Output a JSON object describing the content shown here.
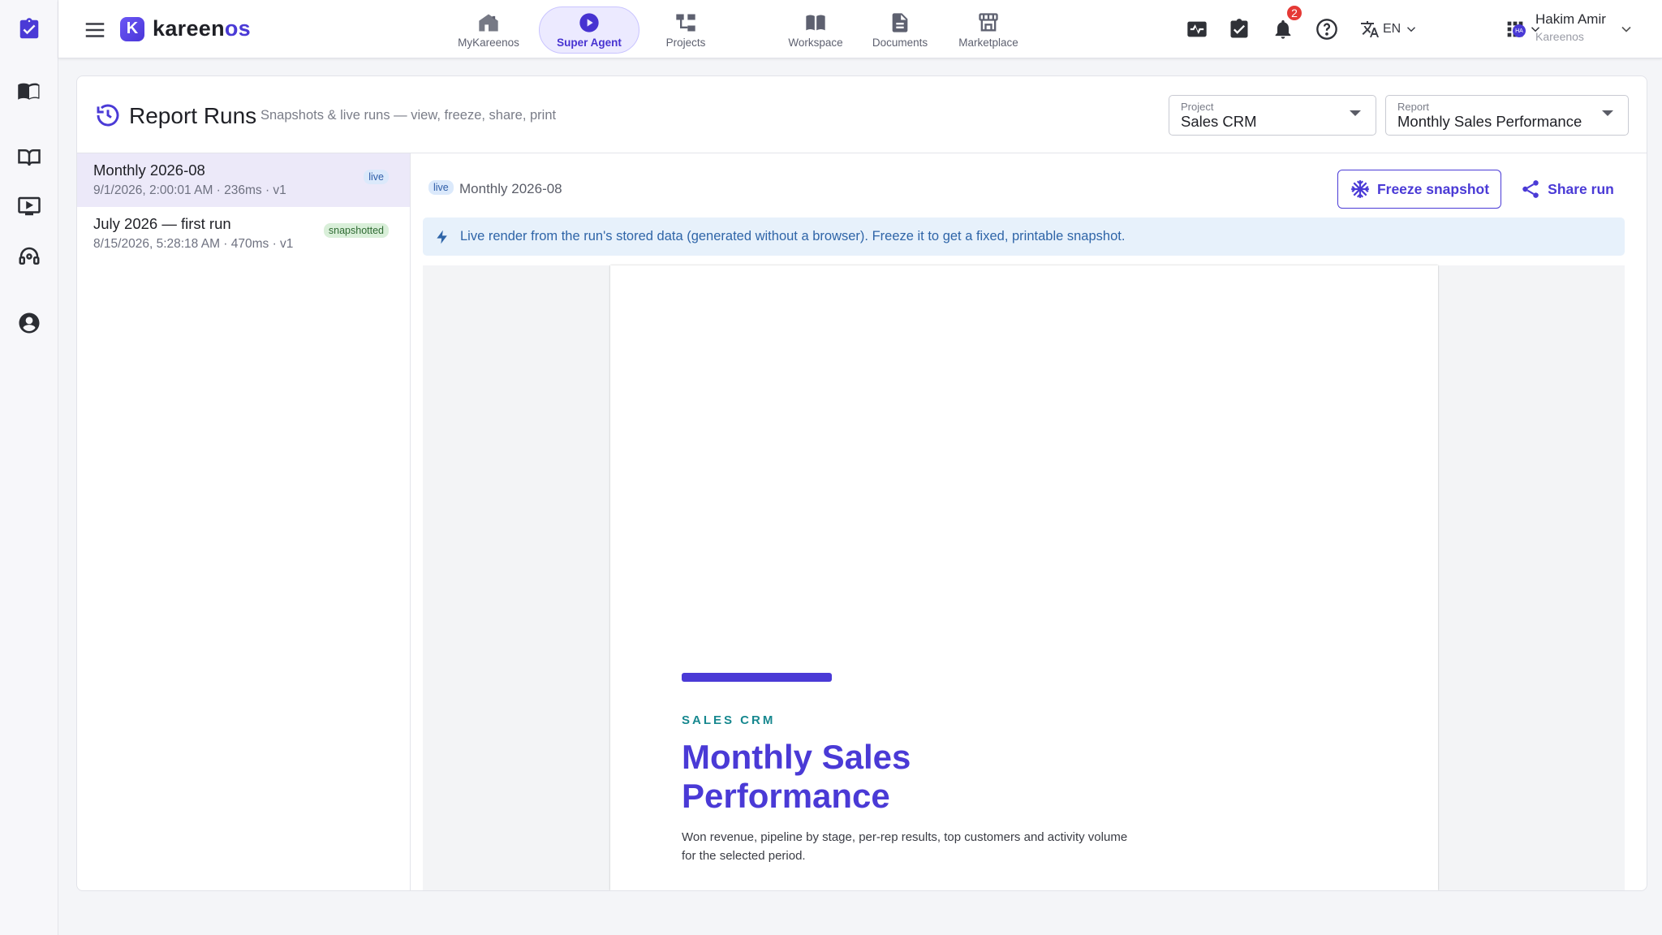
{
  "app": {
    "brand_main": "kareen",
    "brand_accent": "os",
    "logo_letter": "K"
  },
  "nav": [
    {
      "label": "MyKareenos",
      "icon": "home-icon"
    },
    {
      "label": "Super Agent",
      "icon": "play-circle-icon",
      "active": true
    },
    {
      "label": "Projects",
      "icon": "hierarchy-icon"
    },
    {
      "label": "Workspace",
      "icon": "book-icon"
    },
    {
      "label": "Documents",
      "icon": "document-icon"
    },
    {
      "label": "Marketplace",
      "icon": "store-icon"
    }
  ],
  "topbar": {
    "notifications_count": "2",
    "language": "EN"
  },
  "user": {
    "name": "Hakim Amir",
    "org": "Kareenos",
    "initials": "HA"
  },
  "page": {
    "title": "Report Runs",
    "subtitle": "Snapshots & live runs — view, freeze, share, print",
    "project_select": {
      "label": "Project",
      "value": "Sales CRM"
    },
    "report_select": {
      "label": "Report",
      "value": "Monthly Sales Performance"
    }
  },
  "runs": [
    {
      "title": "Monthly 2026-08",
      "meta": "9/1/2026, 2:00:01 AM · 236ms · v1",
      "status": "live",
      "selected": true
    },
    {
      "title": "July 2026 — first run",
      "meta": "8/15/2026, 5:28:18 AM · 470ms · v1",
      "status": "snapshotted",
      "selected": false
    }
  ],
  "viewer": {
    "status_tag": "live",
    "run_title": "Monthly 2026-08",
    "freeze_label": "Freeze snapshot",
    "share_label": "Share run",
    "banner": "Live render from the run's stored data (generated without a browser). Freeze it to get a fixed, printable snapshot."
  },
  "report_preview": {
    "kicker": "SALES CRM",
    "title": "Monthly Sales Performance",
    "description": "Won revenue, pipeline by stage, per-rep results, top customers and activity volume for the selected period."
  },
  "colors": {
    "accent": "#4a3ad6",
    "teal": "#17888f",
    "badge": "#e53935"
  }
}
